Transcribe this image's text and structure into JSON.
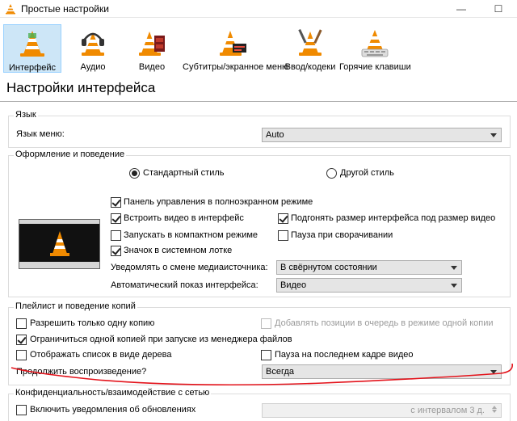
{
  "window": {
    "title": "Простые настройки",
    "minimize_glyph": "—",
    "maximize_glyph": "☐",
    "icon": "vlc-cone-icon"
  },
  "toolbar": [
    {
      "id": "interface",
      "label": "Интерфейс",
      "icon": "vlc-cone-interface-icon",
      "active": true
    },
    {
      "id": "audio",
      "label": "Аудио",
      "icon": "vlc-cone-headphones-icon",
      "active": false
    },
    {
      "id": "video",
      "label": "Видео",
      "icon": "vlc-cone-film-icon",
      "active": false
    },
    {
      "id": "subtitles",
      "label": "Субтитры/экранное меню",
      "icon": "vlc-cone-subtitles-icon",
      "active": false
    },
    {
      "id": "input",
      "label": "Ввод/кодеки",
      "icon": "vlc-cone-tools-icon",
      "active": false
    },
    {
      "id": "hotkeys",
      "label": "Горячие клавиши",
      "icon": "vlc-cone-hotkeys-icon",
      "active": false
    }
  ],
  "page": {
    "title": "Настройки интерфейса"
  },
  "language": {
    "group_title": "Язык",
    "menu_language_label": "Язык меню:",
    "menu_language_value": "Auto"
  },
  "look": {
    "group_title": "Оформление и поведение",
    "style_native_label": "Стандартный стиль",
    "style_native_checked": true,
    "style_skins_label": "Другой стиль",
    "style_skins_checked": false,
    "fullscreen_controls_label": "Панель управления в полноэкранном режиме",
    "fullscreen_controls_checked": true,
    "embed_video_label": "Встроить видео в интерфейс",
    "embed_video_checked": true,
    "resize_interface_label": "Подгонять размер интерфейса под размер видео",
    "resize_interface_checked": true,
    "compact_mode_label": "Запускать в компактном режиме",
    "compact_mode_checked": false,
    "pause_minimized_label": "Пауза при сворачивании",
    "pause_minimized_checked": false,
    "systray_label": "Значок в системном лотке",
    "systray_checked": true,
    "notify_change_label": "Уведомлять о смене медиаисточника:",
    "notify_change_value": "В свёрнутом состоянии",
    "auto_raise_label": "Автоматический показ интерфейса:",
    "auto_raise_value": "Видео"
  },
  "playlist": {
    "group_title": "Плейлист и поведение копий",
    "one_instance_label": "Разрешить только одну копию",
    "one_instance_checked": false,
    "enqueue_label": "Добавлять позиции в очередь в режиме одной копии",
    "enqueue_checked": false,
    "file_manager_label": "Ограничиться одной копией при запуске из менеджера файлов",
    "file_manager_checked": true,
    "tree_label": "Отображать список в виде дерева",
    "tree_checked": false,
    "pause_last_frame_label": "Пауза на последнем кадре видео",
    "pause_last_frame_checked": false,
    "continue_playback_label": "Продолжить воспроизведение?",
    "continue_playback_value": "Всегда"
  },
  "privacy": {
    "group_title": "Конфиденциальность/взаимодействие с сетью",
    "updates_label": "Включить уведомления об обновлениях",
    "updates_checked": false,
    "interval_value": "с интервалом 3 д."
  },
  "colors": {
    "accent_selected": "#cde6f7",
    "annotation_red": "#e3131b",
    "vlc_orange": "#f08a00"
  }
}
